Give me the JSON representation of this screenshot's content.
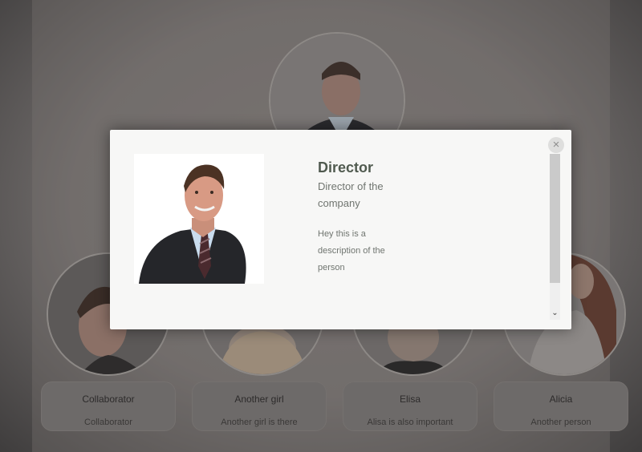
{
  "team": [
    {
      "name": "Collaborator",
      "description": "Collaborator"
    },
    {
      "name": "Another girl",
      "description": "Another girl is there"
    },
    {
      "name": "Elisa",
      "description": "Alisa is also important"
    },
    {
      "name": "Alicia",
      "description": "Another person"
    }
  ],
  "modal": {
    "title": "Director",
    "subtitle": "Director of the company",
    "description": "Hey this is a description of the person",
    "close_icon": "×",
    "scroll_down_icon": "⌄"
  },
  "colors": {
    "overlay": "#6f6c6c",
    "modal_bg": "#f7f7f6",
    "title": "#505a4f",
    "text": "#707570"
  }
}
